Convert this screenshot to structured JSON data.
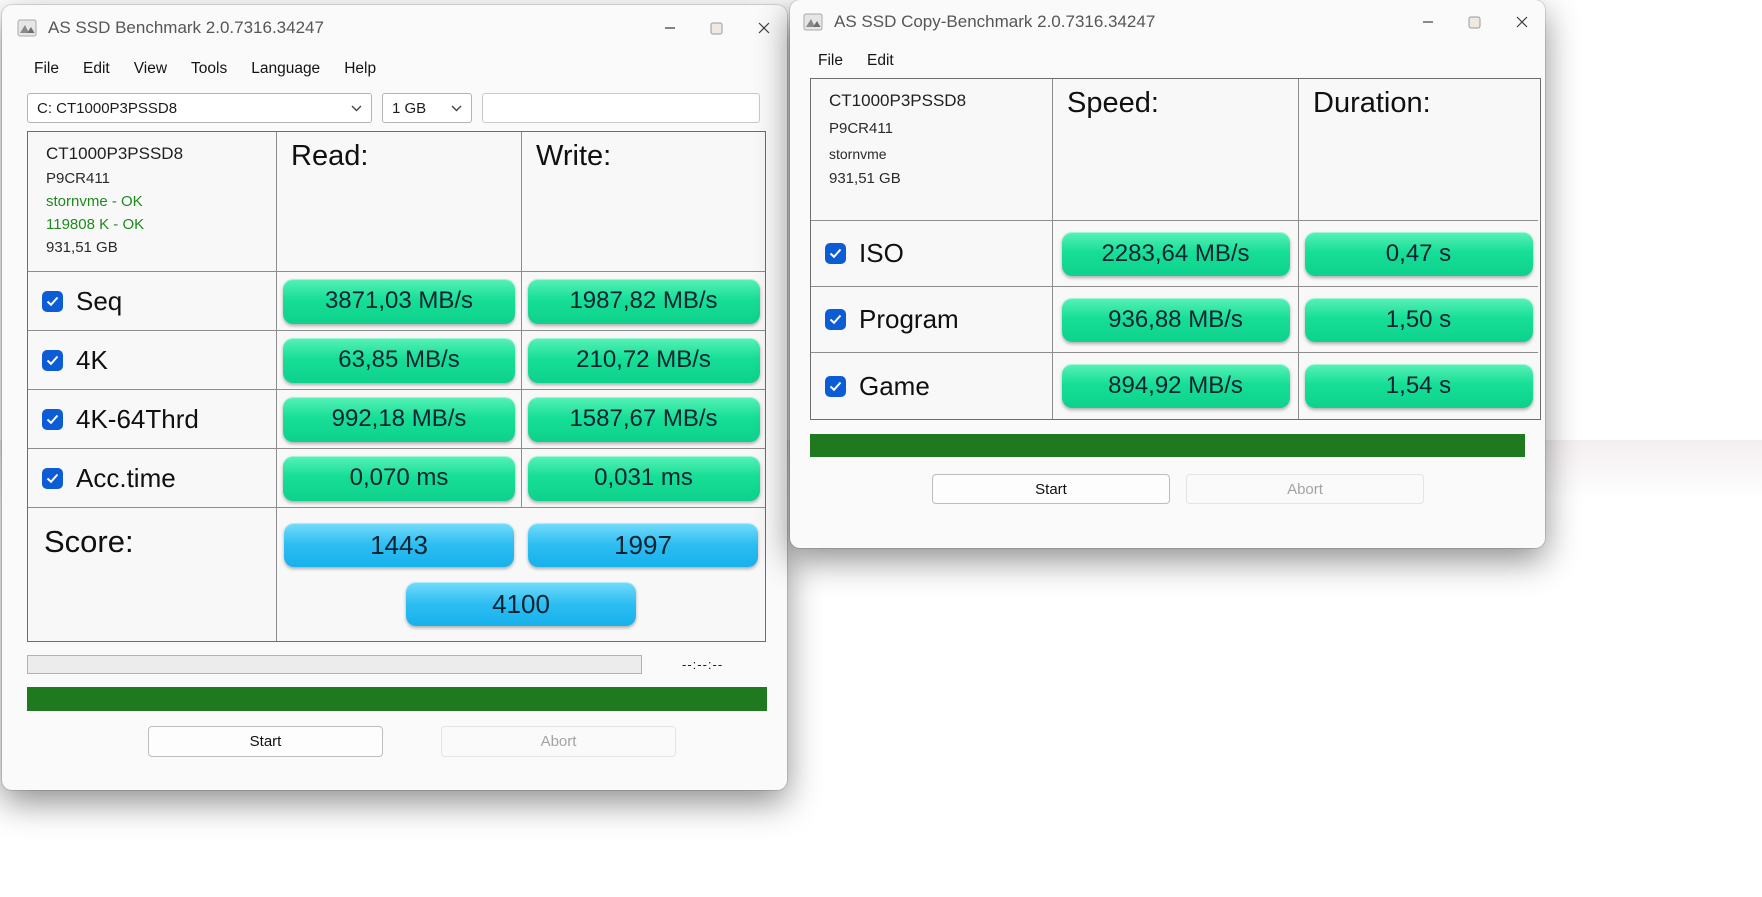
{
  "colors": {
    "value_pill_green": "#17DF97",
    "score_pill_blue": "#2CBDF2",
    "progress_bar_green": "#1F7A1F",
    "status_text_green": "#1E8A1E",
    "checkbox_accent_blue": "#0B5CD5"
  },
  "benchmark_window": {
    "title": "AS SSD Benchmark 2.0.7316.34247",
    "menu": [
      "File",
      "Edit",
      "View",
      "Tools",
      "Language",
      "Help"
    ],
    "toolbar": {
      "drive_value": "C: CT1000P3PSSD8",
      "size_value": "1 GB",
      "field_value": ""
    },
    "device": {
      "model": "CT1000P3PSSD8",
      "firmware": "P9CR411",
      "driver_status": "stornvme - OK",
      "alignment_status": "119808 K - OK",
      "capacity": "931,51 GB"
    },
    "columns": {
      "read": "Read:",
      "write": "Write:"
    },
    "rows": [
      {
        "label": "Seq",
        "read": "3871,03 MB/s",
        "write": "1987,82 MB/s"
      },
      {
        "label": "4K",
        "read": "63,85 MB/s",
        "write": "210,72 MB/s"
      },
      {
        "label": "4K-64Thrd",
        "read": "992,18 MB/s",
        "write": "1587,67 MB/s"
      },
      {
        "label": "Acc.time",
        "read": "0,070 ms",
        "write": "0,031 ms"
      }
    ],
    "score": {
      "label": "Score:",
      "read_score": "1443",
      "write_score": "1997",
      "total_score": "4100"
    },
    "timer": "--:--:--",
    "buttons": {
      "start": "Start",
      "abort": "Abort"
    }
  },
  "copy_window": {
    "title": "AS SSD Copy-Benchmark 2.0.7316.34247",
    "menu": [
      "File",
      "Edit"
    ],
    "device": {
      "model": "CT1000P3PSSD8",
      "firmware": "P9CR411",
      "driver": "stornvme",
      "capacity": "931,51 GB"
    },
    "columns": {
      "speed": "Speed:",
      "duration": "Duration:"
    },
    "rows": [
      {
        "label": "ISO",
        "speed": "2283,64 MB/s",
        "duration": "0,47 s"
      },
      {
        "label": "Program",
        "speed": "936,88 MB/s",
        "duration": "1,50 s"
      },
      {
        "label": "Game",
        "speed": "894,92 MB/s",
        "duration": "1,54 s"
      }
    ],
    "buttons": {
      "start": "Start",
      "abort": "Abort"
    }
  }
}
